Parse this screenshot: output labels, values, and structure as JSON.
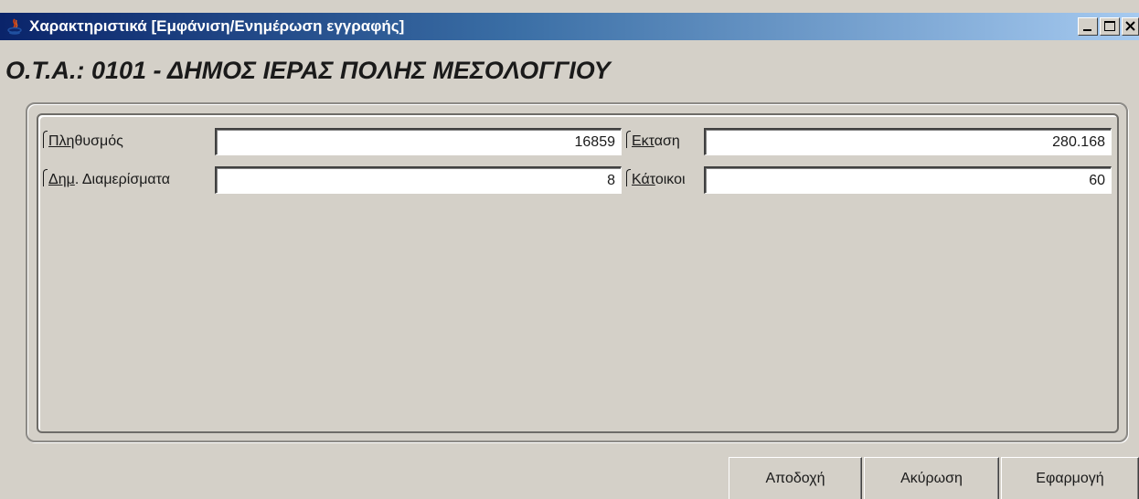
{
  "window": {
    "title": "Χαρακτηριστικά [Εμφάνιση/Ενημέρωση  εγγραφής]",
    "icons": [
      "app-icon",
      "minimize-icon",
      "maximize-icon",
      "close-icon"
    ]
  },
  "heading": "Ο.Τ.Α.: 0101 - ΔΗΜΟΣ ΙΕΡΑΣ ΠΟΛΗΣ ΜΕΣΟΛΟΓΓΙΟΥ",
  "fields": {
    "population": {
      "label_u": "Πλη",
      "label_rest": "θυσμός",
      "value": "16859"
    },
    "area": {
      "label_u": "Εκτ",
      "label_rest": "αση",
      "value": "280.168"
    },
    "districts": {
      "label_u": "Δημ",
      "label_rest": ". Διαμερίσματα",
      "value": "8"
    },
    "residents": {
      "label_u": "Κάτ",
      "label_rest": "οικοι",
      "value": "60"
    }
  },
  "buttons": {
    "accept": "Αποδοχή",
    "cancel": "Ακύρωση",
    "apply": "Εφαρμογή"
  },
  "colors": {
    "window_bg": "#d4d0c8",
    "titlebar_start": "#0a246a",
    "titlebar_end": "#a6caf0",
    "field_bg": "#ffffff"
  }
}
